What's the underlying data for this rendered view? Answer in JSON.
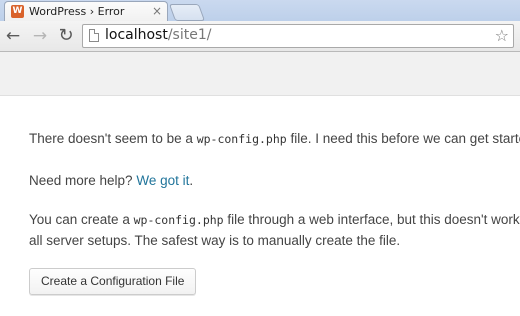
{
  "browser": {
    "tab": {
      "title": "WordPress › Error",
      "favicon": "wordpress-logo"
    },
    "address_bar": {
      "host": "localhost",
      "path": "/site1/"
    },
    "icons": {
      "back": "←",
      "forward": "→",
      "reload": "↻",
      "star": "☆",
      "close": "×"
    }
  },
  "page": {
    "message": {
      "before_code": "There doesn't seem to be a ",
      "code": "wp-config.php",
      "after_code": " file. I need this before we can get started."
    },
    "help": {
      "prefix": "Need more help? ",
      "link_text": "We got it",
      "suffix": "."
    },
    "setup": {
      "before_code": "You can create a ",
      "code": "wp-config.php",
      "after_code": " file through a web interface, but this doesn't work for",
      "line2": "all server setups. The safest way is to manually create the file."
    },
    "button_label": "Create a Configuration File"
  },
  "colors": {
    "link": "#21759b",
    "text": "#444444"
  }
}
